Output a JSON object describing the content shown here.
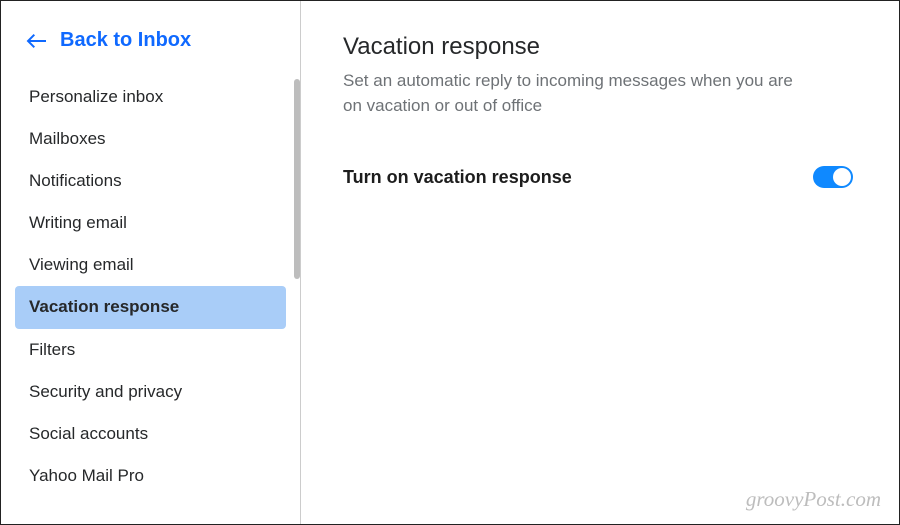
{
  "sidebar": {
    "back_label": "Back to Inbox",
    "items": [
      {
        "label": "Personalize inbox",
        "active": false
      },
      {
        "label": "Mailboxes",
        "active": false
      },
      {
        "label": "Notifications",
        "active": false
      },
      {
        "label": "Writing email",
        "active": false
      },
      {
        "label": "Viewing email",
        "active": false
      },
      {
        "label": "Vacation response",
        "active": true
      },
      {
        "label": "Filters",
        "active": false
      },
      {
        "label": "Security and privacy",
        "active": false
      },
      {
        "label": "Social accounts",
        "active": false
      },
      {
        "label": "Yahoo Mail Pro",
        "active": false
      }
    ]
  },
  "main": {
    "title": "Vacation response",
    "subtitle": "Set an automatic reply to incoming messages when you are on vacation or out of office",
    "toggle_label": "Turn on vacation response",
    "toggle_on": true
  },
  "watermark": "groovyPost.com"
}
